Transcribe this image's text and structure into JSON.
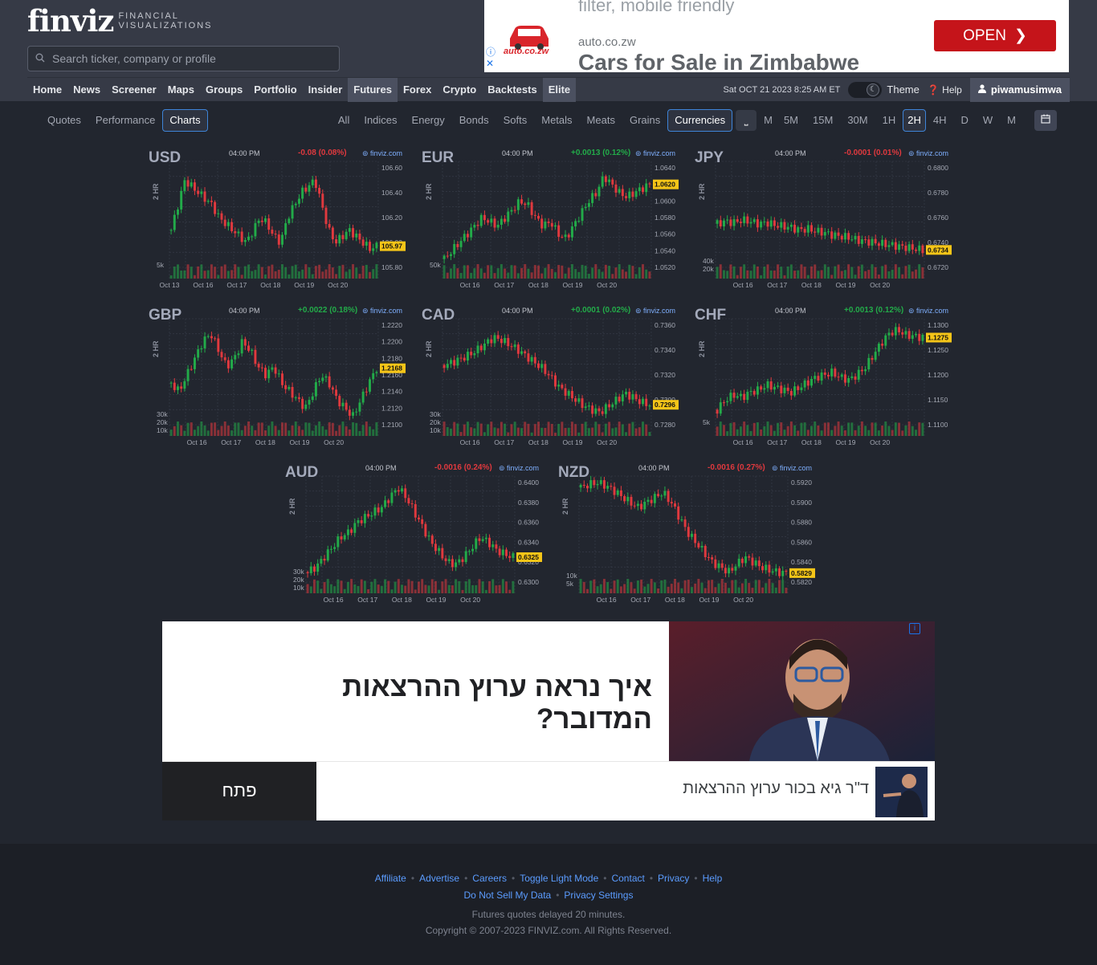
{
  "header": {
    "logo_main": "finviz",
    "logo_sub_1": "FINANCIAL",
    "logo_sub_2": "VISUALIZATIONS",
    "search_placeholder": "Search ticker, company or profile"
  },
  "top_ad": {
    "line1": "filter, mobile friendly",
    "brand": "auto.co.zw",
    "domain": "auto.co.zw",
    "title": "Cars for Sale in Zimbabwe",
    "button": "OPEN",
    "info_icon": "info-icon",
    "close_icon": "close-icon"
  },
  "nav": {
    "items": [
      "Home",
      "News",
      "Screener",
      "Maps",
      "Groups",
      "Portfolio",
      "Insider",
      "Futures",
      "Forex",
      "Crypto",
      "Backtests",
      "Elite"
    ],
    "active": "Futures",
    "date": "Sat OCT 21 2023 8:25 AM ET",
    "theme": "Theme",
    "help": "Help",
    "user": "piwamusimwa"
  },
  "views": {
    "items": [
      "Quotes",
      "Performance",
      "Charts"
    ],
    "selected": "Charts"
  },
  "groups": {
    "items": [
      "All",
      "Indices",
      "Energy",
      "Bonds",
      "Softs",
      "Metals",
      "Meats",
      "Grains",
      "Currencies"
    ],
    "selected": "Currencies"
  },
  "timeframes": {
    "items": [
      "M",
      "5M",
      "15M",
      "30M",
      "1H",
      "2H",
      "4H",
      "D",
      "W",
      "M"
    ],
    "selected": "2H"
  },
  "colors": {
    "up": "#22ab49",
    "down": "#e0393e",
    "price_tag": "#f5c518",
    "accent": "#3e84d8"
  },
  "charts": [
    {
      "name": "USD",
      "time": "04:00 PM",
      "change": "-0.08 (0.08%)",
      "dir": "down",
      "source": "finviz.com",
      "period": "2 HR",
      "yticks": [
        "106.60",
        "106.40",
        "106.20",
        "106.00",
        "105.80"
      ],
      "last": "105.97",
      "volticks": [
        "5k"
      ],
      "xticks": [
        "Oct 13",
        "Oct 16",
        "Oct 17",
        "Oct 18",
        "Oct 19",
        "Oct 20"
      ],
      "series": [
        106.1,
        106.3,
        106.5,
        106.45,
        106.4,
        106.35,
        106.3,
        106.2,
        106.15,
        106.1,
        106.05,
        106.0,
        106.1,
        106.2,
        106.15,
        106.05,
        106.0,
        106.2,
        106.3,
        106.4,
        106.45,
        106.5,
        106.3,
        106.1,
        106.0,
        106.05,
        106.1,
        106.05,
        106.0,
        105.95,
        105.97
      ]
    },
    {
      "name": "EUR",
      "time": "04:00 PM",
      "change": "+0.0013 (0.12%)",
      "dir": "up",
      "source": "finviz.com",
      "period": "2 HR",
      "yticks": [
        "1.0640",
        "1.0620",
        "1.0600",
        "1.0580",
        "1.0560",
        "1.0540",
        "1.0520"
      ],
      "last": "1.0620",
      "volticks": [
        "50k"
      ],
      "xticks": [
        "Oct 16",
        "Oct 17",
        "Oct 18",
        "Oct 19",
        "Oct 20"
      ],
      "series": [
        1.053,
        1.054,
        1.055,
        1.056,
        1.057,
        1.058,
        1.0575,
        1.057,
        1.058,
        1.059,
        1.06,
        1.0595,
        1.058,
        1.057,
        1.0575,
        1.056,
        1.0555,
        1.057,
        1.0585,
        1.06,
        1.061,
        1.063,
        1.062,
        1.061,
        1.0605,
        1.061,
        1.0615,
        1.062
      ]
    },
    {
      "name": "JPY",
      "time": "04:00 PM",
      "change": "-0.0001 (0.01%)",
      "dir": "down",
      "source": "finviz.com",
      "period": "2 HR",
      "yticks": [
        "0.6800",
        "0.6780",
        "0.6760",
        "0.6740",
        "0.6720"
      ],
      "last": "0.6734",
      "volticks": [
        "40k",
        "20k"
      ],
      "xticks": [
        "Oct 16",
        "Oct 17",
        "Oct 18",
        "Oct 19",
        "Oct 20"
      ],
      "series": [
        0.6755,
        0.6757,
        0.6756,
        0.6758,
        0.6757,
        0.6755,
        0.6756,
        0.6754,
        0.6753,
        0.6752,
        0.675,
        0.6751,
        0.6749,
        0.6748,
        0.6746,
        0.6745,
        0.6744,
        0.6742,
        0.6741,
        0.674,
        0.6739,
        0.6738,
        0.6737,
        0.6736,
        0.6735,
        0.6734
      ]
    },
    {
      "name": "GBP",
      "time": "04:00 PM",
      "change": "+0.0022 (0.18%)",
      "dir": "up",
      "source": "finviz.com",
      "period": "2 HR",
      "yticks": [
        "1.2220",
        "1.2200",
        "1.2180",
        "1.2160",
        "1.2140",
        "1.2120",
        "1.2100"
      ],
      "last": "1.2168",
      "volticks": [
        "30k",
        "20k",
        "10k"
      ],
      "xticks": [
        "Oct 16",
        "Oct 17",
        "Oct 18",
        "Oct 19",
        "Oct 20"
      ],
      "series": [
        1.215,
        1.214,
        1.216,
        1.218,
        1.22,
        1.221,
        1.219,
        1.217,
        1.218,
        1.22,
        1.219,
        1.217,
        1.216,
        1.217,
        1.215,
        1.214,
        1.213,
        1.212,
        1.214,
        1.216,
        1.215,
        1.213,
        1.212,
        1.211,
        1.213,
        1.215,
        1.2168
      ]
    },
    {
      "name": "CAD",
      "time": "04:00 PM",
      "change": "+0.0001 (0.02%)",
      "dir": "up",
      "source": "finviz.com",
      "period": "2 HR",
      "yticks": [
        "0.7360",
        "0.7340",
        "0.7320",
        "0.7300",
        "0.7280"
      ],
      "last": "0.7296",
      "volticks": [
        "30k",
        "20k",
        "10k"
      ],
      "xticks": [
        "Oct 16",
        "Oct 17",
        "Oct 18",
        "Oct 19",
        "Oct 20"
      ],
      "series": [
        0.7328,
        0.733,
        0.7333,
        0.7336,
        0.734,
        0.7345,
        0.735,
        0.7348,
        0.7344,
        0.734,
        0.7335,
        0.733,
        0.7325,
        0.7318,
        0.731,
        0.7305,
        0.73,
        0.7295,
        0.7292,
        0.729,
        0.7295,
        0.73,
        0.7305,
        0.7302,
        0.7298,
        0.7296
      ]
    },
    {
      "name": "CHF",
      "time": "04:00 PM",
      "change": "+0.0013 (0.12%)",
      "dir": "up",
      "source": "finviz.com",
      "period": "2 HR",
      "yticks": [
        "1.1300",
        "1.1250",
        "1.1200",
        "1.1150",
        "1.1100"
      ],
      "last": "1.1275",
      "volticks": [
        "5k"
      ],
      "xticks": [
        "Oct 16",
        "Oct 17",
        "Oct 18",
        "Oct 19",
        "Oct 20"
      ],
      "series": [
        1.113,
        1.115,
        1.116,
        1.1155,
        1.1165,
        1.117,
        1.118,
        1.1175,
        1.117,
        1.1165,
        1.1175,
        1.1185,
        1.1195,
        1.12,
        1.1205,
        1.1195,
        1.119,
        1.12,
        1.1215,
        1.124,
        1.1265,
        1.1285,
        1.129,
        1.128,
        1.1278,
        1.1275
      ]
    },
    {
      "name": "AUD",
      "time": "04:00 PM",
      "change": "-0.0016 (0.24%)",
      "dir": "down",
      "source": "finviz.com",
      "period": "2 HR",
      "yticks": [
        "0.6400",
        "0.6380",
        "0.6360",
        "0.6340",
        "0.6320",
        "0.6300"
      ],
      "last": "0.6325",
      "volticks": [
        "30k",
        "20k",
        "10k"
      ],
      "xticks": [
        "Oct 16",
        "Oct 17",
        "Oct 18",
        "Oct 19",
        "Oct 20"
      ],
      "series": [
        0.631,
        0.6315,
        0.6325,
        0.6335,
        0.6345,
        0.635,
        0.636,
        0.6365,
        0.637,
        0.6375,
        0.6385,
        0.6395,
        0.6385,
        0.637,
        0.6355,
        0.634,
        0.633,
        0.632,
        0.6318,
        0.6325,
        0.6335,
        0.6345,
        0.634,
        0.6332,
        0.6328,
        0.6325
      ]
    },
    {
      "name": "NZD",
      "time": "04:00 PM",
      "change": "-0.0016 (0.27%)",
      "dir": "down",
      "source": "finviz.com",
      "period": "2 HR",
      "yticks": [
        "0.5920",
        "0.5900",
        "0.5880",
        "0.5860",
        "0.5840",
        "0.5820"
      ],
      "last": "0.5829",
      "volticks": [
        "10k",
        "5k"
      ],
      "xticks": [
        "Oct 16",
        "Oct 17",
        "Oct 18",
        "Oct 19",
        "Oct 20"
      ],
      "series": [
        0.5915,
        0.5918,
        0.592,
        0.5917,
        0.5912,
        0.5906,
        0.59,
        0.5895,
        0.59,
        0.5905,
        0.591,
        0.59,
        0.5885,
        0.587,
        0.586,
        0.585,
        0.584,
        0.5835,
        0.583,
        0.5838,
        0.5845,
        0.584,
        0.5835,
        0.5832,
        0.583,
        0.5829
      ]
    }
  ],
  "big_ad": {
    "headline": "איך נראה ערוץ ההרצאות המדובר?",
    "subtext": "ד\"ר גיא בכור ערוץ ההרצאות",
    "button": "פתח"
  },
  "footer": {
    "links_row1": [
      "Affiliate",
      "Advertise",
      "Careers",
      "Toggle Light Mode",
      "Contact",
      "Privacy",
      "Help"
    ],
    "links_row2": [
      "Do Not Sell My Data",
      "Privacy Settings"
    ],
    "delay_note": "Futures quotes delayed 20 minutes.",
    "copyright": "Copyright © 2007-2023 FINVIZ.com. All Rights Reserved."
  }
}
